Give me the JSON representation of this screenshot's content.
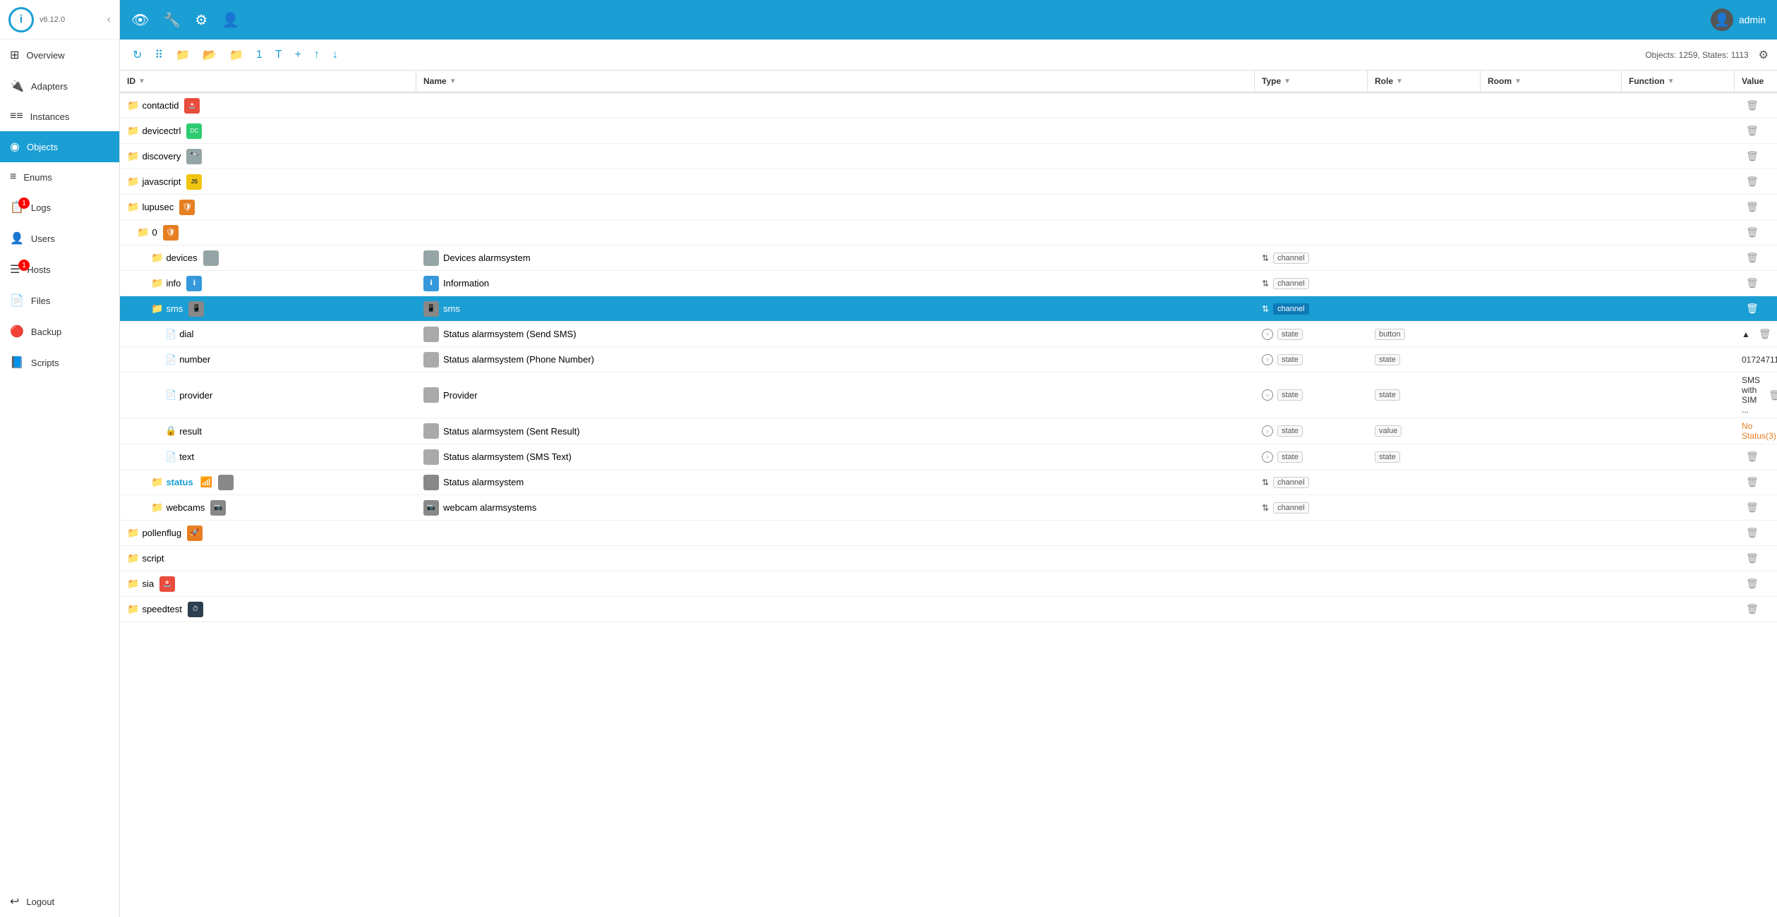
{
  "app": {
    "version": "v6.12.0",
    "user": "admin"
  },
  "sidebar": {
    "items": [
      {
        "id": "overview",
        "label": "Overview",
        "icon": "⊞",
        "active": false,
        "badge": null
      },
      {
        "id": "adapters",
        "label": "Adapters",
        "icon": "🔌",
        "active": false,
        "badge": null
      },
      {
        "id": "instances",
        "label": "Instances",
        "icon": "≡≡",
        "active": false,
        "badge": null
      },
      {
        "id": "objects",
        "label": "Objects",
        "icon": "◉",
        "active": true,
        "badge": null
      },
      {
        "id": "enums",
        "label": "Enums",
        "icon": "≡",
        "active": false,
        "badge": null
      },
      {
        "id": "logs",
        "label": "Logs",
        "icon": "📋",
        "active": false,
        "badge": "1"
      },
      {
        "id": "users",
        "label": "Users",
        "icon": "👤",
        "active": false,
        "badge": null
      },
      {
        "id": "hosts",
        "label": "Hosts",
        "icon": "☰",
        "active": false,
        "badge": "1"
      },
      {
        "id": "files",
        "label": "Files",
        "icon": "📄",
        "active": false,
        "badge": null
      },
      {
        "id": "backup",
        "label": "Backup",
        "icon": "🔴",
        "active": false,
        "badge": null
      },
      {
        "id": "scripts",
        "label": "Scripts",
        "icon": "📘",
        "active": false,
        "badge": null
      },
      {
        "id": "logout",
        "label": "Logout",
        "icon": "↩",
        "active": false,
        "badge": null
      }
    ]
  },
  "topbar": {
    "icons": [
      "👁",
      "🔧",
      "⚙",
      "👤"
    ],
    "user": "admin"
  },
  "toolbar": {
    "objects_info": "Objects: 1259, States: 1113"
  },
  "table": {
    "columns": [
      "ID",
      "Name",
      "Type",
      "Role",
      "Room",
      "Function",
      "Value"
    ],
    "rows": [
      {
        "id": "contactid",
        "indent": 0,
        "type": "folder",
        "icon_color": "red",
        "icon_text": "🚨",
        "name": "",
        "obj_type": "",
        "role": "",
        "room": "",
        "function": "",
        "value": ""
      },
      {
        "id": "devicectrl",
        "indent": 0,
        "type": "folder",
        "icon_color": "green",
        "icon_text": "DC",
        "name": "",
        "obj_type": "",
        "role": "",
        "room": "",
        "function": "",
        "value": ""
      },
      {
        "id": "discovery",
        "indent": 0,
        "type": "folder",
        "icon_color": "gray",
        "icon_text": "🔭",
        "name": "",
        "obj_type": "",
        "role": "",
        "room": "",
        "function": "",
        "value": ""
      },
      {
        "id": "javascript",
        "indent": 0,
        "type": "folder",
        "icon_color": "yellow",
        "icon_text": "JS",
        "name": "",
        "obj_type": "",
        "role": "",
        "room": "",
        "function": "",
        "value": ""
      },
      {
        "id": "lupusec",
        "indent": 0,
        "type": "folder",
        "icon_color": "orange",
        "icon_text": "🛡",
        "name": "",
        "obj_type": "",
        "role": "",
        "room": "",
        "function": "",
        "value": ""
      },
      {
        "id": "0",
        "indent": 1,
        "type": "folder",
        "icon_color": "orange",
        "icon_text": "🛡",
        "name": "",
        "obj_type": "",
        "role": "",
        "room": "",
        "function": "",
        "value": ""
      },
      {
        "id": "devices",
        "indent": 2,
        "type": "folder",
        "icon_color": "gray",
        "icon_text": "",
        "name": "Devices alarmsystem",
        "obj_type": "channel",
        "role": "",
        "room": "",
        "function": "",
        "value": ""
      },
      {
        "id": "info",
        "indent": 2,
        "type": "folder",
        "icon_color": "blue-icon",
        "icon_text": "ℹ",
        "name": "Information",
        "obj_type": "channel",
        "role": "",
        "room": "",
        "function": "",
        "value": ""
      },
      {
        "id": "sms",
        "indent": 2,
        "type": "folder",
        "icon_color": "gray",
        "icon_text": "📱",
        "name": "sms",
        "obj_type": "channel",
        "role": "",
        "room": "",
        "function": "",
        "value": "",
        "selected": true
      },
      {
        "id": "dial",
        "indent": 3,
        "type": "file",
        "icon_color": "",
        "icon_text": "",
        "name": "Status alarmsystem (Send SMS)",
        "obj_type": "state",
        "role": "button",
        "room": "",
        "function": "",
        "value": "▲"
      },
      {
        "id": "number",
        "indent": 3,
        "type": "file",
        "icon_color": "",
        "icon_text": "",
        "name": "Status alarmsystem (Phone Number)",
        "obj_type": "state",
        "role": "state",
        "room": "",
        "function": "",
        "value": "01724711"
      },
      {
        "id": "provider",
        "indent": 3,
        "type": "file",
        "icon_color": "",
        "icon_text": "",
        "name": "Provider",
        "obj_type": "state",
        "role": "state",
        "room": "",
        "function": "",
        "value": "SMS with SIM ..."
      },
      {
        "id": "result",
        "indent": 3,
        "type": "file",
        "icon_color": "",
        "icon_text": "",
        "name": "Status alarmsystem (Sent Result)",
        "obj_type": "state",
        "role": "value",
        "room": "",
        "function": "",
        "value": "No Status(3)",
        "value_color": "orange"
      },
      {
        "id": "text",
        "indent": 3,
        "type": "file",
        "icon_color": "",
        "icon_text": "",
        "name": "Status alarmsystem (SMS Text)",
        "obj_type": "state",
        "role": "state",
        "room": "",
        "function": "",
        "value": ""
      },
      {
        "id": "status",
        "indent": 2,
        "type": "folder",
        "icon_color": "gray",
        "icon_text": "wifi",
        "name": "Status alarmsystem",
        "obj_type": "channel",
        "role": "",
        "room": "",
        "function": "",
        "value": ""
      },
      {
        "id": "webcams",
        "indent": 2,
        "type": "folder",
        "icon_color": "gray",
        "icon_text": "📷",
        "name": "webcam alarmsystems",
        "obj_type": "channel",
        "role": "",
        "room": "",
        "function": "",
        "value": ""
      },
      {
        "id": "pollenflug",
        "indent": 0,
        "type": "folder",
        "icon_color": "orange",
        "icon_text": "🚀",
        "name": "",
        "obj_type": "",
        "role": "",
        "room": "",
        "function": "",
        "value": ""
      },
      {
        "id": "script",
        "indent": 0,
        "type": "folder",
        "icon_color": "",
        "icon_text": "",
        "name": "",
        "obj_type": "",
        "role": "",
        "room": "",
        "function": "",
        "value": ""
      },
      {
        "id": "sia",
        "indent": 0,
        "type": "folder",
        "icon_color": "red",
        "icon_text": "🚨",
        "name": "",
        "obj_type": "",
        "role": "",
        "room": "",
        "function": "",
        "value": ""
      },
      {
        "id": "speedtest",
        "indent": 0,
        "type": "folder",
        "icon_color": "dark",
        "icon_text": "⏱",
        "name": "",
        "obj_type": "",
        "role": "",
        "room": "",
        "function": "",
        "value": ""
      }
    ]
  }
}
